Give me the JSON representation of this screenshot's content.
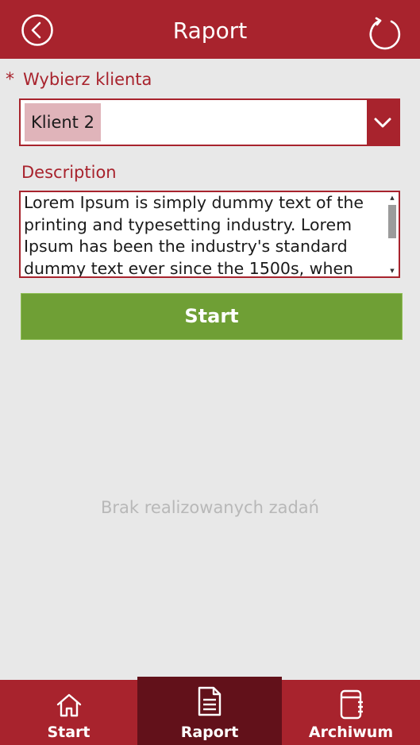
{
  "header": {
    "title": "Raport"
  },
  "form": {
    "required_marker": "*",
    "client_label": "Wybierz klienta",
    "client_value": "Klient 2",
    "description_label": "Description",
    "description_text": "Lorem Ipsum is simply dummy text of the\nprinting and typesetting industry. Lorem\nIpsum has been the industry's standard\ndummy text ever since the 1500s, when"
  },
  "actions": {
    "start_label": "Start"
  },
  "status": {
    "empty_message": "Brak realizowanych zadań"
  },
  "nav": {
    "items": [
      {
        "label": "Start",
        "icon": "home-icon"
      },
      {
        "label": "Raport",
        "icon": "document-icon",
        "active": true
      },
      {
        "label": "Archiwum",
        "icon": "notebook-icon"
      }
    ]
  },
  "colors": {
    "primary": "#a8232d",
    "active_nav": "#62111a",
    "start_button": "#6f9f35",
    "selected_chip": "#e0b4ba",
    "background": "#e8e8e8"
  }
}
